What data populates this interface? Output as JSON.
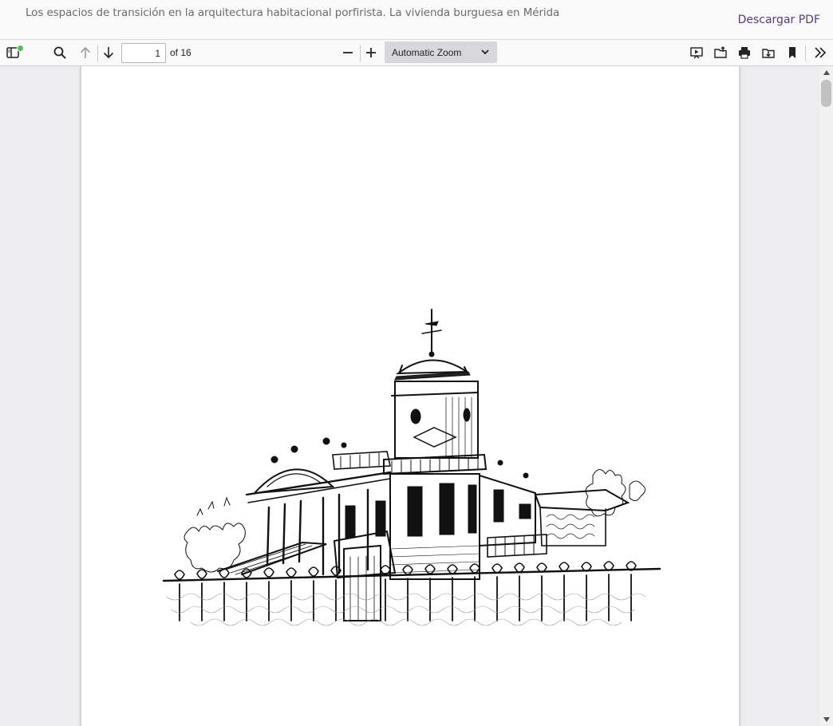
{
  "header": {
    "document_title": "Los espacios de transición en la arquitectura habitacional porfirista. La vivienda burguesa en Mérida",
    "download_label": "Descargar PDF"
  },
  "toolbar": {
    "sidebar_icon": "sidebar-toggle-icon",
    "search_icon": "search-icon",
    "prev_icon": "arrow-up-icon",
    "next_icon": "arrow-down-icon",
    "page_number": "1",
    "page_count": "of 16",
    "zoom_out_icon": "minus-icon",
    "zoom_in_icon": "plus-icon",
    "zoom_value": "Automatic Zoom",
    "presentation_icon": "presentation-icon",
    "open_icon": "open-file-icon",
    "print_icon": "print-icon",
    "download_icon": "download-icon",
    "bookmark_icon": "bookmark-icon",
    "tools_icon": "double-chevron-right-icon"
  },
  "colors": {
    "accent_link": "#5a3a78",
    "notification_dot": "#54c05a",
    "toolbar_bg": "#f9f9fa",
    "viewer_bg": "#ededf0"
  }
}
